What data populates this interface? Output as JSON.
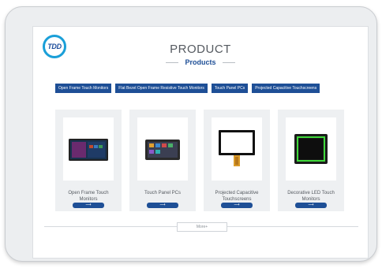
{
  "header": {
    "logo_text": "TDD",
    "title": "PRODUCT",
    "subtitle": "Products"
  },
  "tabs": [
    {
      "label": "Open Frame Touch Monitors"
    },
    {
      "label": "Flat Bezel Open Frame Resistive Touch Monitors"
    },
    {
      "label": "Touch Panel PCs"
    },
    {
      "label": "Projected Capacitive Touchscreens"
    }
  ],
  "cards": [
    {
      "label": "Open Frame Touch Monitors",
      "icon": "touch-monitor-icon"
    },
    {
      "label": "Touch Panel PCs",
      "icon": "panel-pc-icon"
    },
    {
      "label": "Projected Capacitive Touchscreens",
      "icon": "touchscreen-icon"
    },
    {
      "label": "Decorative LED Touch Monitors",
      "icon": "led-monitor-icon"
    }
  ],
  "more_label": "More+",
  "colors": {
    "accent": "#1e4f96",
    "logo_ring": "#1a9fd8",
    "led_glow": "#3fd83a"
  }
}
